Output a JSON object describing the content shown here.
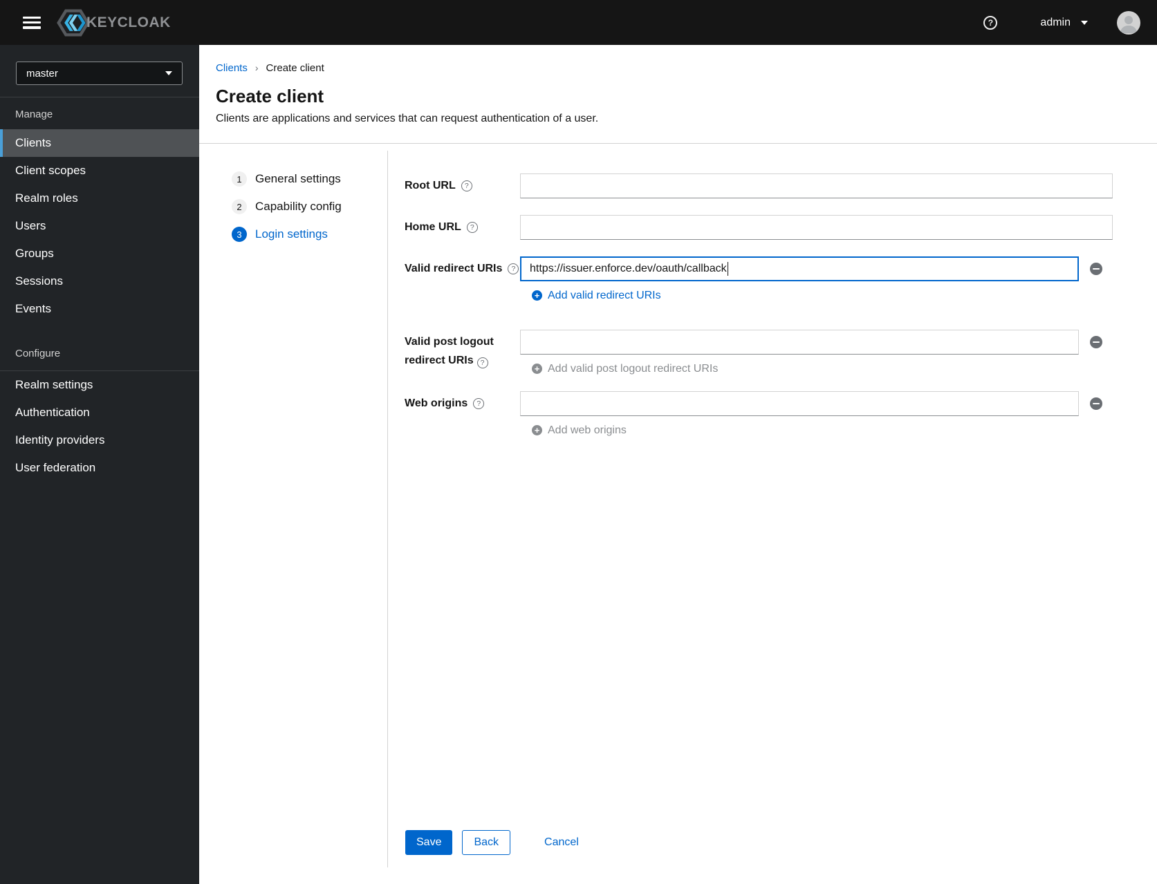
{
  "masthead": {
    "brand_text": "KEYCLOAK",
    "username": "admin"
  },
  "sidebar": {
    "realm_selector": {
      "value": "master"
    },
    "sections": [
      {
        "title": "Manage",
        "items": [
          {
            "label": "Clients",
            "active": true
          },
          {
            "label": "Client scopes"
          },
          {
            "label": "Realm roles"
          },
          {
            "label": "Users"
          },
          {
            "label": "Groups"
          },
          {
            "label": "Sessions"
          },
          {
            "label": "Events"
          }
        ]
      },
      {
        "title": "Configure",
        "items": [
          {
            "label": "Realm settings"
          },
          {
            "label": "Authentication"
          },
          {
            "label": "Identity providers"
          },
          {
            "label": "User federation"
          }
        ]
      }
    ]
  },
  "breadcrumb": {
    "link": "Clients",
    "separator": "›",
    "current": "Create client"
  },
  "page_header": {
    "title": "Create client",
    "subtitle": "Clients are applications and services that can request authentication of a user."
  },
  "wizard_steps": [
    {
      "number": "1",
      "label": "General settings",
      "current": false
    },
    {
      "number": "2",
      "label": "Capability config",
      "current": false
    },
    {
      "number": "3",
      "label": "Login settings",
      "current": true
    }
  ],
  "form": {
    "root_url": {
      "label": "Root URL",
      "value": ""
    },
    "home_url": {
      "label": "Home URL",
      "value": ""
    },
    "valid_redirect_uris": {
      "label": "Valid redirect URIs",
      "value": "https://issuer.enforce.dev/oauth/callback",
      "add_label": "Add valid redirect URIs",
      "enabled": true
    },
    "valid_post_logout_redirect_uris": {
      "label": "Valid post logout redirect URIs",
      "value": "",
      "add_label": "Add valid post logout redirect URIs",
      "enabled": false
    },
    "web_origins": {
      "label": "Web origins",
      "value": "",
      "add_label": "Add web origins",
      "enabled": false
    },
    "actions": {
      "save": "Save",
      "back": "Back",
      "cancel": "Cancel"
    }
  },
  "colors": {
    "accent": "#0066cc",
    "masthead_bg": "#151515",
    "sidebar_bg": "#212427",
    "active_item_bg": "#4f5255",
    "active_item_border": "#4a9fd8",
    "muted_gray": "#6a6e73",
    "disabled_text": "#8a8d90"
  }
}
